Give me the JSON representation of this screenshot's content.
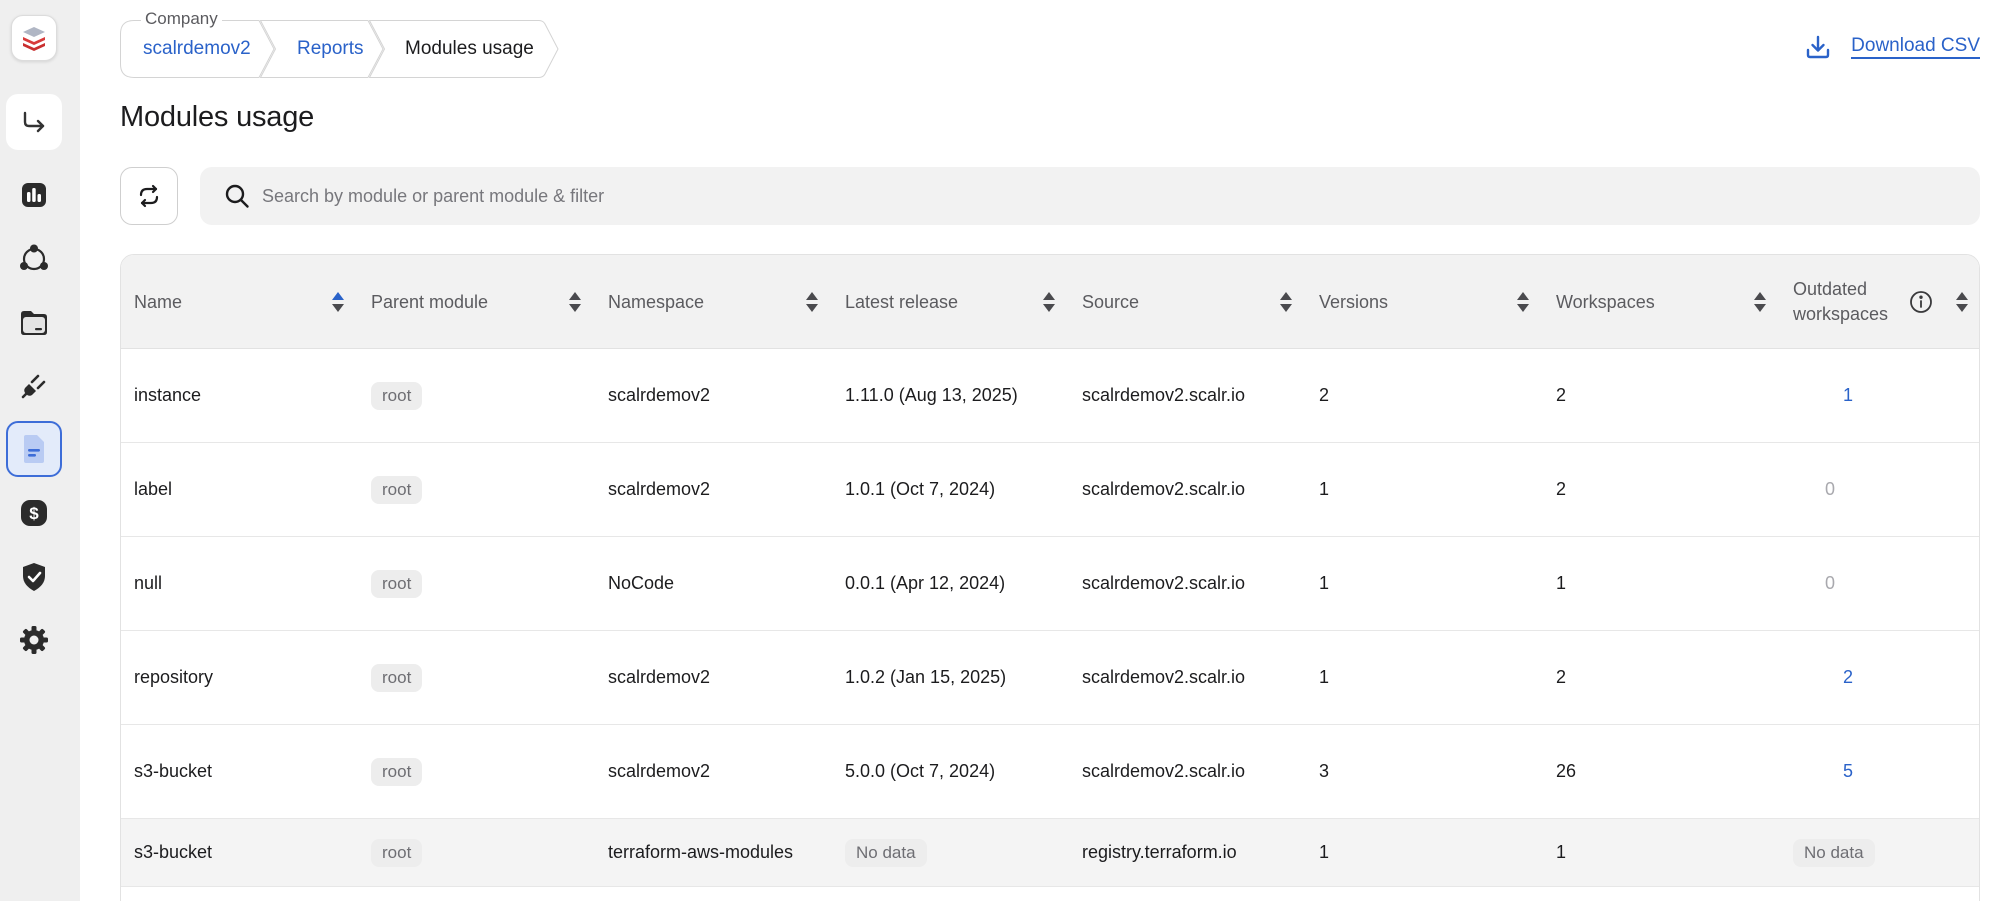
{
  "breadcrumb": {
    "company_label": "Company",
    "items": [
      "scalrdemov2",
      "Reports",
      "Modules usage"
    ]
  },
  "download": {
    "label": "Download CSV",
    "icon": "download-icon"
  },
  "page_title": "Modules usage",
  "search": {
    "placeholder": "Search by module or parent module & filter",
    "value": ""
  },
  "sidebar": {
    "icons": [
      "logo-icon",
      "exit-icon",
      "dashboard-icon",
      "environments-icon",
      "folder-icon",
      "plug-icon",
      "reports-icon",
      "billing-icon",
      "policy-icon",
      "settings-icon"
    ],
    "active": "reports-icon"
  },
  "colors": {
    "accent": "#2a62c9",
    "active_bg": "#e3ebfa",
    "header_bg": "#f2f2f2"
  },
  "table": {
    "columns": [
      "Name",
      "Parent module",
      "Namespace",
      "Latest release",
      "Source",
      "Versions",
      "Workspaces",
      "Outdated workspaces"
    ],
    "outdated_col_line1": "Outdated",
    "outdated_col_line2": "workspaces",
    "rows": [
      {
        "name": "instance",
        "parent": "root",
        "namespace": "scalrdemov2",
        "release": "1.11.0 (Aug 13, 2025)",
        "source": "scalrdemov2.scalr.io",
        "versions": "2",
        "workspaces": "2",
        "outdated": "1"
      },
      {
        "name": "label",
        "parent": "root",
        "namespace": "scalrdemov2",
        "release": "1.0.1 (Oct 7, 2024)",
        "source": "scalrdemov2.scalr.io",
        "versions": "1",
        "workspaces": "2",
        "outdated": "0"
      },
      {
        "name": "null",
        "parent": "root",
        "namespace": "NoCode",
        "release": "0.0.1 (Apr 12, 2024)",
        "source": "scalrdemov2.scalr.io",
        "versions": "1",
        "workspaces": "1",
        "outdated": "0"
      },
      {
        "name": "repository",
        "parent": "root",
        "namespace": "scalrdemov2",
        "release": "1.0.2 (Jan 15, 2025)",
        "source": "scalrdemov2.scalr.io",
        "versions": "1",
        "workspaces": "2",
        "outdated": "2"
      },
      {
        "name": "s3-bucket",
        "parent": "root",
        "namespace": "scalrdemov2",
        "release": "5.0.0 (Oct 7, 2024)",
        "source": "scalrdemov2.scalr.io",
        "versions": "3",
        "workspaces": "26",
        "outdated": "5"
      },
      {
        "name": "s3-bucket",
        "parent": "root",
        "namespace": "terraform-aws-modules",
        "release": "No data",
        "source": "registry.terraform.io",
        "versions": "1",
        "workspaces": "1",
        "outdated": "No data"
      }
    ]
  }
}
